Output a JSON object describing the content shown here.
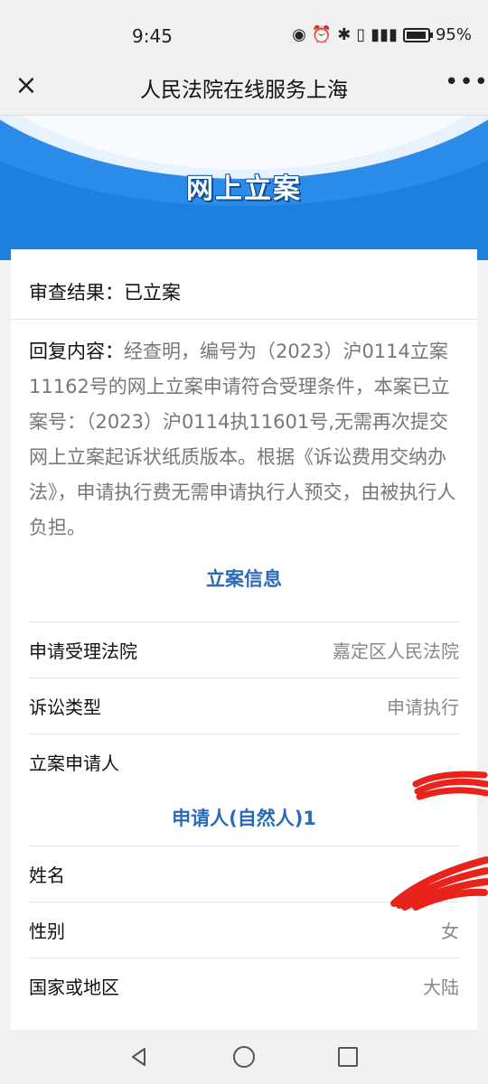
{
  "status": {
    "time": "9:45",
    "battery": "95%",
    "battery_level": 0.95
  },
  "header": {
    "title": "人民法院在线服务上海",
    "close_icon": "×",
    "more_icon": "•••"
  },
  "banner": {
    "title": "网上立案"
  },
  "result": {
    "label": "审查结果：",
    "value": "已立案"
  },
  "reply": {
    "label": "回复内容：",
    "content": "经查明，编号为（2023）沪0114立案11162号的网上立案申请符合受理条件，本案已立案号：（2023）沪0114执11601号,无需再次提交网上立案起诉状纸质版本。根据《诉讼费用交纳办法》，申请执行费无需申请执行人预交，由被执行人负担。"
  },
  "sections": {
    "case_info": "立案信息",
    "applicant": "申请人(自然人)1"
  },
  "case_rows": [
    {
      "key": "申请受理法院",
      "value": "嘉定区人民法院"
    },
    {
      "key": "诉讼类型",
      "value": "申请执行"
    },
    {
      "key": "立案申请人",
      "value": ""
    }
  ],
  "applicant_rows": [
    {
      "key": "姓名",
      "value": ""
    },
    {
      "key": "性别",
      "value": "女"
    },
    {
      "key": "国家或地区",
      "value": "大陆"
    }
  ],
  "colors": {
    "accent": "#2a6bb8",
    "banner": "#1d7fe0",
    "redaction": "#e8231c"
  },
  "icons": [
    "close-icon",
    "more-icon",
    "eye-icon",
    "alarm-icon",
    "bluetooth-icon",
    "vibrate-icon",
    "signal-icon",
    "battery-icon",
    "back-icon",
    "home-icon",
    "recent-apps-icon"
  ]
}
